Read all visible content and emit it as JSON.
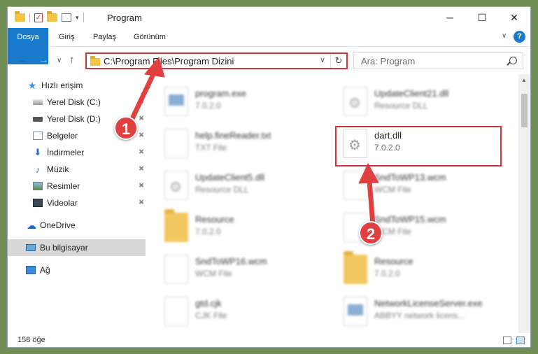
{
  "window": {
    "title": "Program",
    "controls": {
      "minimize": "─",
      "maximize": "☐",
      "close": "✕"
    }
  },
  "ribbon": {
    "tabs": [
      "Dosya",
      "Giriş",
      "Paylaş",
      "Görünüm"
    ],
    "help": "?",
    "accent": "#1979ca"
  },
  "address": {
    "path": "C:\\Program Files\\Program Dizini",
    "search_placeholder": "Ara: Program"
  },
  "sidebar": {
    "items": [
      {
        "label": "Hızlı erişim",
        "icon": "star-icon"
      },
      {
        "label": "Yerel Disk (C:)",
        "icon": "drive-icon",
        "pinned": true
      },
      {
        "label": "Yerel Disk (D:)",
        "icon": "drive-icon",
        "pinned": true
      },
      {
        "label": "Belgeler",
        "icon": "documents-icon",
        "pinned": true
      },
      {
        "label": "İndirmeler",
        "icon": "downloads-icon",
        "pinned": true
      },
      {
        "label": "Müzik",
        "icon": "music-icon",
        "pinned": true
      },
      {
        "label": "Resimler",
        "icon": "pictures-icon",
        "pinned": true
      },
      {
        "label": "Videolar",
        "icon": "videos-icon",
        "pinned": true
      },
      {
        "label": "OneDrive",
        "icon": "cloud-icon"
      },
      {
        "label": "Bu bilgisayar",
        "icon": "computer-icon",
        "selected": true
      },
      {
        "label": "Ağ",
        "icon": "network-icon"
      }
    ]
  },
  "files": [
    {
      "name": "program.exe",
      "detail": "7.0.2.0",
      "icon": "exe-icon",
      "blurred": true
    },
    {
      "name": "UpdateClient21.dll",
      "detail": "Resource DLL",
      "icon": "dll-icon",
      "blurred": true
    },
    {
      "name": "help.fineReader.txt",
      "detail": "TXT File",
      "icon": "txt-icon",
      "blurred": true
    },
    {
      "name": "dart.dll",
      "detail": "7.0.2.0",
      "icon": "dll-icon",
      "blurred": false
    },
    {
      "name": "UpdateClient5.dll",
      "detail": "Resource DLL",
      "icon": "dll-icon",
      "blurred": true
    },
    {
      "name": "SndToWP13.wcm",
      "detail": "WCM File",
      "icon": "file-icon",
      "blurred": true
    },
    {
      "name": "Resource",
      "detail": "7.0.2.0",
      "icon": "folder-icon",
      "blurred": true
    },
    {
      "name": "SndToWP15.wcm",
      "detail": "WCM File",
      "icon": "file-icon",
      "blurred": true
    },
    {
      "name": "SndToWP16.wcm",
      "detail": "WCM File",
      "icon": "file-icon",
      "blurred": true
    },
    {
      "name": "Resource",
      "detail": "7.0.2.0",
      "icon": "folder-icon",
      "blurred": true
    },
    {
      "name": "gtd.cjk",
      "detail": "CJK File",
      "icon": "file-icon",
      "blurred": true
    },
    {
      "name": "NetworkLicenseServer.exe",
      "detail": "ABBYY network licens...",
      "icon": "app-icon",
      "blurred": true
    }
  ],
  "status": {
    "count": "158 öğe"
  },
  "annotations": {
    "step1": "1",
    "step2": "2",
    "highlight_color": "#d0343c"
  }
}
